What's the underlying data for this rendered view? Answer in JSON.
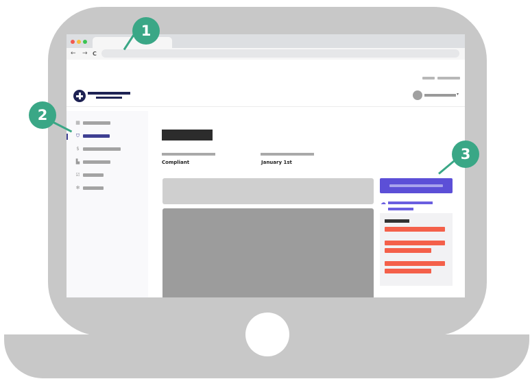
{
  "colors": {
    "laptop": "#c8c8c8",
    "accent": "#5c4fd7",
    "callout": "#3aa786",
    "findings": "#f4604a",
    "logo": "#1e2253"
  },
  "browser": {
    "nav_icons": {
      "back": "←",
      "forward": "→",
      "refresh": "C"
    },
    "window_dots": [
      "#f25a4f",
      "#f7be3a",
      "#3bc452"
    ]
  },
  "sidebar": {
    "items": [
      {
        "icon": "grid-icon"
      },
      {
        "icon": "shield-check-icon",
        "active": true
      },
      {
        "icon": "dollar-icon"
      },
      {
        "icon": "document-icon"
      },
      {
        "icon": "checkbox-icon"
      },
      {
        "icon": "gear-icon"
      }
    ]
  },
  "main": {
    "status_value": "Compliant",
    "date_value": "January 1st"
  },
  "right_panel": {
    "download_icon": "cloud-upload-icon",
    "findings_count": 3
  },
  "callouts": [
    {
      "label": "1"
    },
    {
      "label": "2"
    },
    {
      "label": "3"
    }
  ]
}
